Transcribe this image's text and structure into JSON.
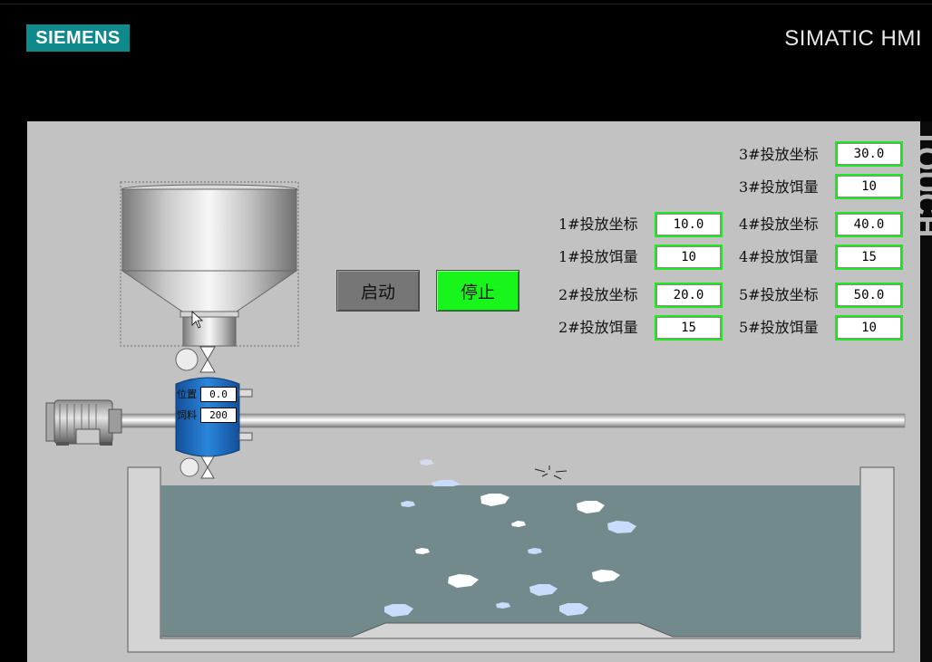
{
  "header": {
    "brand": "SIEMENS",
    "product": "SIMATIC HMI",
    "side_text": "TOUCH"
  },
  "controls": {
    "start_label": "启动",
    "stop_label": "停止"
  },
  "feeder": {
    "position_label": "位置",
    "position_value": "0.0",
    "feed_label": "饲料",
    "feed_value": "200"
  },
  "params": [
    {
      "id": "p1-coord",
      "label": "1#投放坐标",
      "value": "10.0"
    },
    {
      "id": "p1-amount",
      "label": "1#投放饵量",
      "value": "10"
    },
    {
      "id": "p2-coord",
      "label": "2#投放坐标",
      "value": "20.0"
    },
    {
      "id": "p2-amount",
      "label": "2#投放饵量",
      "value": "15"
    },
    {
      "id": "p3-coord",
      "label": "3#投放坐标",
      "value": "30.0"
    },
    {
      "id": "p3-amount",
      "label": "3#投放饵量",
      "value": "10"
    },
    {
      "id": "p4-coord",
      "label": "4#投放坐标",
      "value": "40.0"
    },
    {
      "id": "p4-amount",
      "label": "4#投放饵量",
      "value": "15"
    },
    {
      "id": "p5-coord",
      "label": "5#投放坐标",
      "value": "50.0"
    },
    {
      "id": "p5-amount",
      "label": "5#投放饵量",
      "value": "10"
    }
  ],
  "colors": {
    "accent_green": "#18f51b",
    "field_border": "#1fea1f",
    "feeder_blue": "#1f74c9",
    "water": "#738a8d",
    "brand_teal": "#0f8a8c"
  }
}
